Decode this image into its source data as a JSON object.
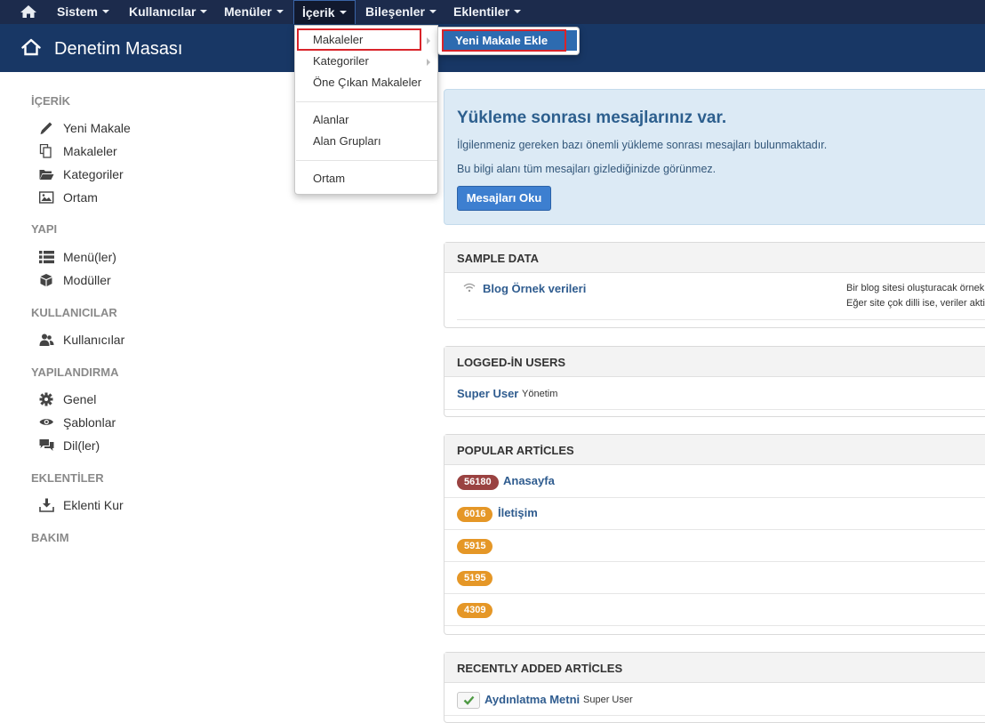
{
  "navbar": {
    "home_icon": "home-icon",
    "items": [
      {
        "label": "Sistem"
      },
      {
        "label": "Kullanıcılar"
      },
      {
        "label": "Menüler"
      },
      {
        "label": "İçerik"
      },
      {
        "label": "Bileşenler"
      },
      {
        "label": "Eklentiler"
      }
    ],
    "active": "İçerik"
  },
  "header": {
    "title": "Denetim Masası",
    "icon": "home-outline-icon"
  },
  "dropdown": {
    "items": [
      "Makaleler",
      "Kategoriler",
      "Öne Çıkan Makaleler",
      "Alanlar",
      "Alan Grupları",
      "Ortam"
    ],
    "submenu_item": "Yeni Makale Ekle",
    "highlight_color": "#d9242a"
  },
  "sidebar": {
    "sections": [
      {
        "title": "İÇERİK",
        "items": [
          {
            "label": "Yeni Makale",
            "icon": "pencil-icon"
          },
          {
            "label": "Makaleler",
            "icon": "copy-icon"
          },
          {
            "label": "Kategoriler",
            "icon": "folder-open-icon"
          },
          {
            "label": "Ortam",
            "icon": "image-icon"
          }
        ]
      },
      {
        "title": "YAPI",
        "items": [
          {
            "label": "Menü(ler)",
            "icon": "list-icon"
          },
          {
            "label": "Modüller",
            "icon": "cube-icon"
          }
        ]
      },
      {
        "title": "KULLANICILAR",
        "items": [
          {
            "label": "Kullanıcılar",
            "icon": "users-icon"
          }
        ]
      },
      {
        "title": "YAPILANDIRMA",
        "items": [
          {
            "label": "Genel",
            "icon": "cog-icon"
          },
          {
            "label": "Şablonlar",
            "icon": "eye-icon"
          },
          {
            "label": "Dil(ler)",
            "icon": "comments-icon"
          }
        ]
      },
      {
        "title": "EKLENTİLER",
        "items": [
          {
            "label": "Eklenti Kur",
            "icon": "download-icon"
          }
        ]
      },
      {
        "title": "BAKIM",
        "items": []
      }
    ]
  },
  "message": {
    "title": "Yükleme sonrası mesajlarınız var.",
    "line1": "İlgilenmeniz gereken bazı önemli yükleme sonrası mesajları bulunmaktadır.",
    "line2": "Bu bilgi alanı tüm mesajları gizlediğinizde görünmez.",
    "button": "Mesajları Oku",
    "button_color": "#3d7fd0"
  },
  "sample_data": {
    "title": "SAMPLE DATA",
    "item": "Blog Örnek verileri",
    "desc1": "Bir blog sitesi oluşturacak örnek",
    "desc2": "Eğer site çok dilli ise, veriler akti"
  },
  "logged_in": {
    "title": "LOGGED-İN USERS",
    "user": "Super User",
    "role": "Yönetim"
  },
  "popular": {
    "title": "POPULAR ARTİCLES",
    "rows": [
      {
        "hits": "56180",
        "title": "Anasayfa",
        "color": "#9a4241"
      },
      {
        "hits": "6016",
        "title": "İletişim",
        "color": "#e59727"
      },
      {
        "hits": "5915",
        "title": "",
        "color": "#e59727"
      },
      {
        "hits": "5195",
        "title": "",
        "color": "#e59727"
      },
      {
        "hits": "4309",
        "title": "",
        "color": "#e59727"
      }
    ]
  },
  "recent": {
    "title": "RECENTLY ADDED ARTİCLES",
    "item": "Aydınlatma Metni",
    "author": "Super User"
  }
}
